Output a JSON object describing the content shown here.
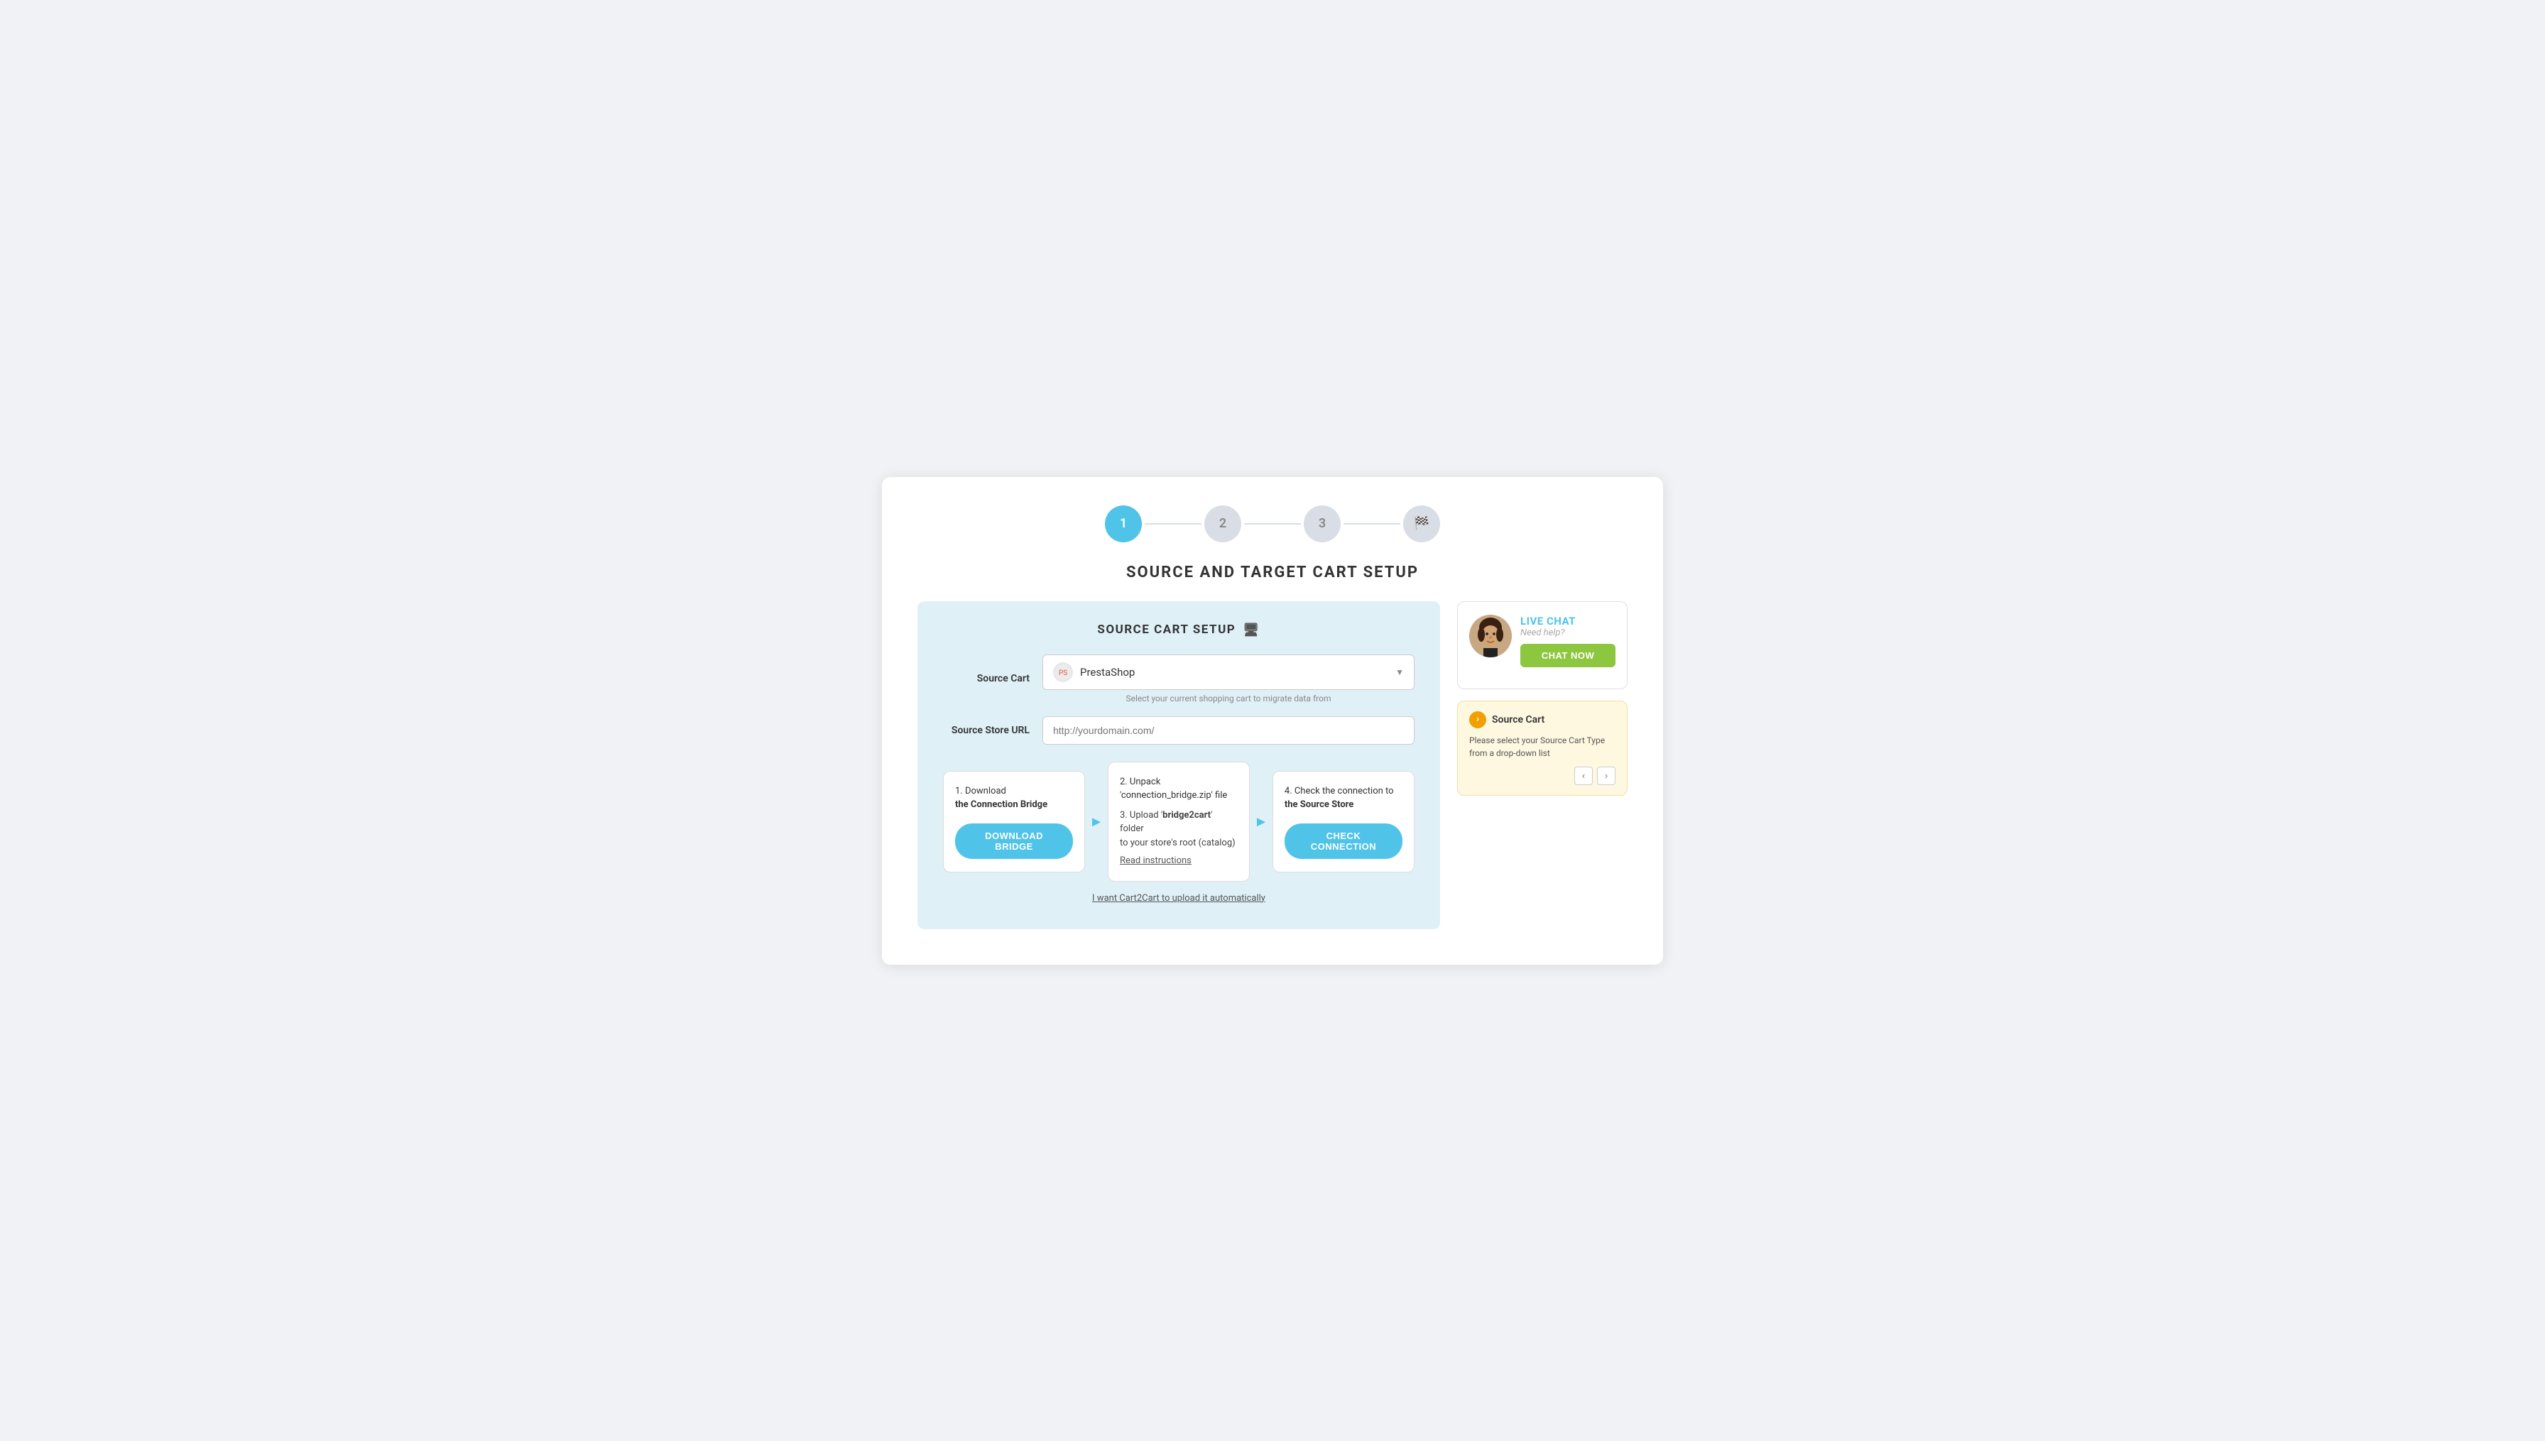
{
  "stepper": {
    "steps": [
      {
        "label": "1",
        "state": "active"
      },
      {
        "label": "2",
        "state": "inactive"
      },
      {
        "label": "3",
        "state": "inactive"
      },
      {
        "label": "🏁",
        "state": "inactive"
      }
    ]
  },
  "page": {
    "title": "SOURCE AND TARGET CART SETUP"
  },
  "source_panel": {
    "title": "SOURCE CART SETUP",
    "source_cart_label": "Source Cart",
    "source_cart_value": "PrestaShop",
    "source_cart_hint": "Select your current shopping cart to migrate data from",
    "source_url_label": "Source Store URL",
    "source_url_placeholder": "http://yourdomain.com/"
  },
  "steps": {
    "step1": {
      "number": "1.",
      "line1": "Download",
      "line2": "the Connection Bridge",
      "button": "DOWNLOAD BRIDGE"
    },
    "step2": {
      "number": "2.",
      "line1": "Unpack",
      "line2": "'connection_bridge.zip' file",
      "step3_number": "3.",
      "step3_line1": "Upload '",
      "step3_bold": "bridge2cart",
      "step3_line2": "' folder",
      "step3_line3": "to your store's root (catalog)",
      "read_instructions": "Read instructions"
    },
    "step4": {
      "number": "4.",
      "line1": "Check the connection to",
      "line2": "the Source Store",
      "button": "CHECK CONNECTION"
    },
    "auto_upload": "I want Cart2Cart to upload it automatically"
  },
  "help": {
    "live_chat_label": "LIVE CHAT",
    "need_help": "Need help?",
    "chat_button": "CHAT NOW"
  },
  "tip": {
    "title": "Source Cart",
    "text": "Please select your Source Cart Type from a drop-down list",
    "prev_button": "‹",
    "next_button": "›"
  }
}
